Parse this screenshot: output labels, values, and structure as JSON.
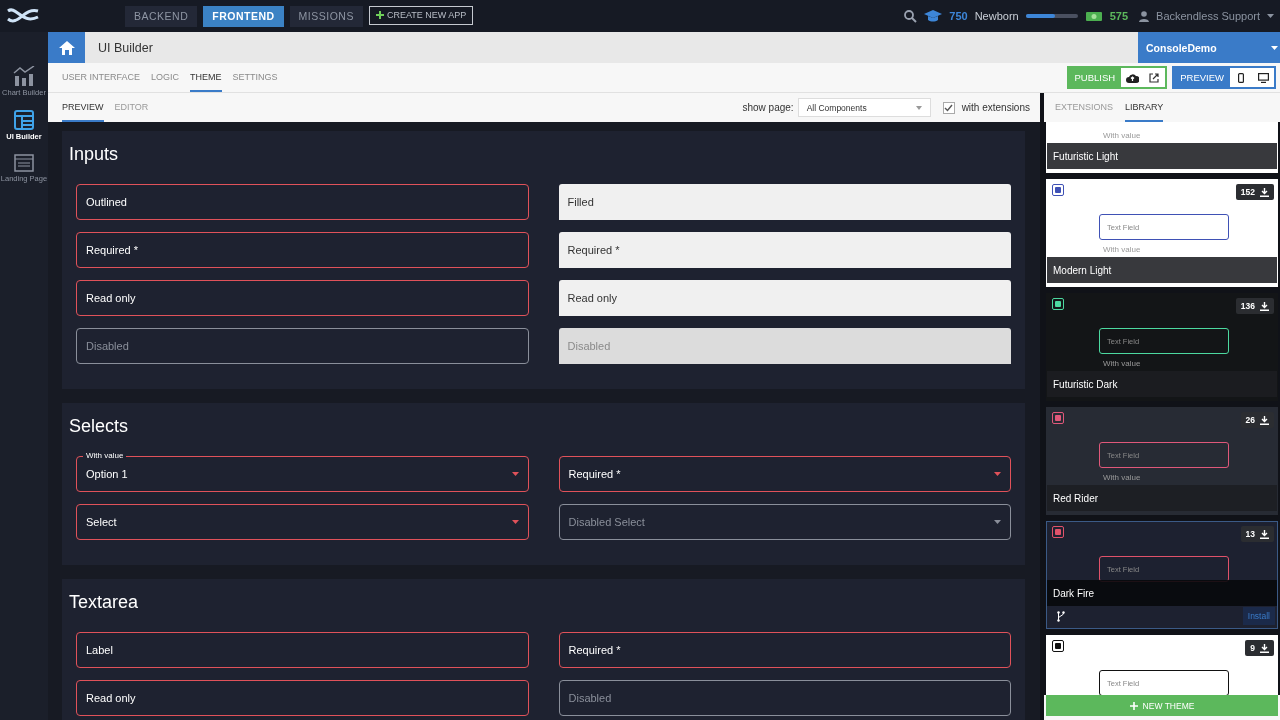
{
  "top_nav": {
    "tabs": [
      {
        "label": "BACKEND",
        "selected": false
      },
      {
        "label": "FRONTEND",
        "selected": true
      },
      {
        "label": "MISSIONS",
        "selected": false
      }
    ],
    "create_button": "CREATE NEW APP"
  },
  "user_bar": {
    "points": "750",
    "rank": "Newborn",
    "level": 0.57,
    "coins": "575",
    "user": "Backendless Support"
  },
  "sidebar": {
    "items": [
      {
        "label": "Chart Builder",
        "kind": "chart",
        "selected": false
      },
      {
        "label": "UI Builder",
        "kind": "layout",
        "selected": true
      },
      {
        "label": "Landing Page",
        "kind": "page",
        "selected": false
      }
    ]
  },
  "header": {
    "title": "UI Builder",
    "app": "ConsoleDemo"
  },
  "tabs": [
    {
      "label": "USER INTERFACE",
      "selected": false
    },
    {
      "label": "LOGIC",
      "selected": false
    },
    {
      "label": "THEME",
      "selected": true
    },
    {
      "label": "SETTINGS",
      "selected": false
    }
  ],
  "publish_button": "PUBLISH",
  "preview_button": "PREVIEW",
  "subtabs": [
    {
      "label": "PREVIEW",
      "selected": true
    },
    {
      "label": "EDITOR",
      "selected": false
    }
  ],
  "show_page": {
    "label": "show page:",
    "value": "All Components"
  },
  "extensions": {
    "label": "with extensions",
    "checked": true
  },
  "panel_tabs": [
    {
      "label": "EXTENSIONS",
      "selected": false
    },
    {
      "label": "LIBRARY",
      "selected": true
    }
  ],
  "sections": [
    {
      "title": "Inputs",
      "fields": [
        {
          "kind": "outlined",
          "label": "Outlined",
          "disabled": false
        },
        {
          "kind": "filled",
          "label": "Filled",
          "disabled": false
        },
        {
          "kind": "outlined",
          "label": "Required *",
          "disabled": false
        },
        {
          "kind": "filled",
          "label": "Required *",
          "disabled": false
        },
        {
          "kind": "outlined",
          "label": "Read only",
          "disabled": false
        },
        {
          "kind": "filled",
          "label": "Read only",
          "disabled": false
        },
        {
          "kind": "outlined",
          "label": "Disabled",
          "disabled": true
        },
        {
          "kind": "filled",
          "label": "Disabled",
          "disabled": true
        }
      ]
    },
    {
      "title": "Selects",
      "fields": [
        {
          "kind": "select",
          "label": "Option 1",
          "floating_label": "With value",
          "disabled": false
        },
        {
          "kind": "select",
          "label": "Required *",
          "disabled": false
        },
        {
          "kind": "select",
          "label": "Select",
          "disabled": false
        },
        {
          "kind": "select",
          "label": "Disabled Select",
          "disabled": true
        }
      ]
    },
    {
      "title": "Textarea",
      "fields": [
        {
          "kind": "outlined",
          "label": "Label",
          "disabled": false
        },
        {
          "kind": "outlined",
          "label": "Required *",
          "disabled": false
        },
        {
          "kind": "outlined",
          "label": "Read only",
          "disabled": false
        },
        {
          "kind": "outlined",
          "label": "Disabled",
          "disabled": true
        }
      ]
    }
  ],
  "themes": [
    {
      "name": "Futuristic Light",
      "kind": "light",
      "select_label": "With value",
      "selected": false
    },
    {
      "name": "Modern Light",
      "kind": "light",
      "color": "#3f51b5",
      "downloads": "152",
      "field_text": "Text Field",
      "select_label": "With value",
      "selected": false
    },
    {
      "name": "Futuristic Dark",
      "kind": "dark",
      "color": "#4cd9a0",
      "downloads": "136",
      "field_text": "Text Field",
      "select_label": "With value",
      "selected": false
    },
    {
      "name": "Red Rider",
      "kind": "slate",
      "color": "#e0587a",
      "downloads": "26",
      "field_text": "Text Field",
      "select_label": "With value",
      "selected": false
    },
    {
      "name": "Dark Fire",
      "kind": "navy",
      "color": "#e0526a",
      "downloads": "13",
      "field_text": "Text Field",
      "selected": true,
      "install_button": "Install"
    },
    {
      "kind": "light",
      "color": "#111111",
      "downloads": "9",
      "field_text": "Text Field",
      "selected": false
    }
  ],
  "new_theme_button": "NEW THEME"
}
